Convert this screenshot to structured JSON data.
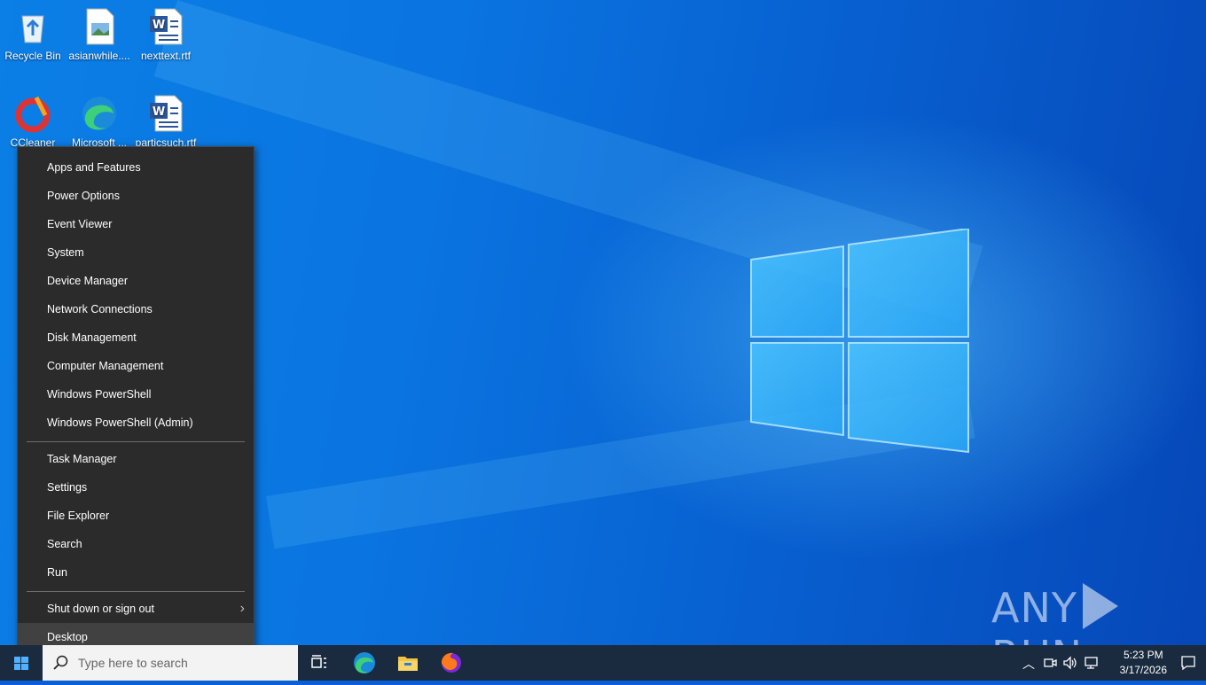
{
  "desktop_icons": [
    {
      "label": "Recycle Bin",
      "icon": "recycle-bin-icon"
    },
    {
      "label": "asianwhile....",
      "icon": "image-file-icon"
    },
    {
      "label": "nexttext.rtf",
      "icon": "word-document-icon"
    },
    {
      "label": "CCleaner",
      "icon": "ccleaner-icon"
    },
    {
      "label": "Microsoft ...",
      "icon": "edge-icon"
    },
    {
      "label": "particsuch.rtf",
      "icon": "word-document-icon"
    }
  ],
  "context_menu": {
    "group1": [
      "Apps and Features",
      "Power Options",
      "Event Viewer",
      "System",
      "Device Manager",
      "Network Connections",
      "Disk Management",
      "Computer Management",
      "Windows PowerShell",
      "Windows PowerShell (Admin)"
    ],
    "group2": [
      "Task Manager",
      "Settings",
      "File Explorer",
      "Search",
      "Run"
    ],
    "group3": [
      "Shut down or sign out",
      "Desktop"
    ]
  },
  "taskbar": {
    "search_placeholder": "Type here to search",
    "clock_time": "5:23 PM",
    "clock_date": "3/17/2026"
  },
  "watermark": {
    "left": "ANY",
    "right": "RUN"
  },
  "colors": {
    "menu_bg": "#2b2b2b",
    "menu_hover": "#414141",
    "taskbar": "#1a2a3f",
    "desktop": "#0a6fdc"
  }
}
